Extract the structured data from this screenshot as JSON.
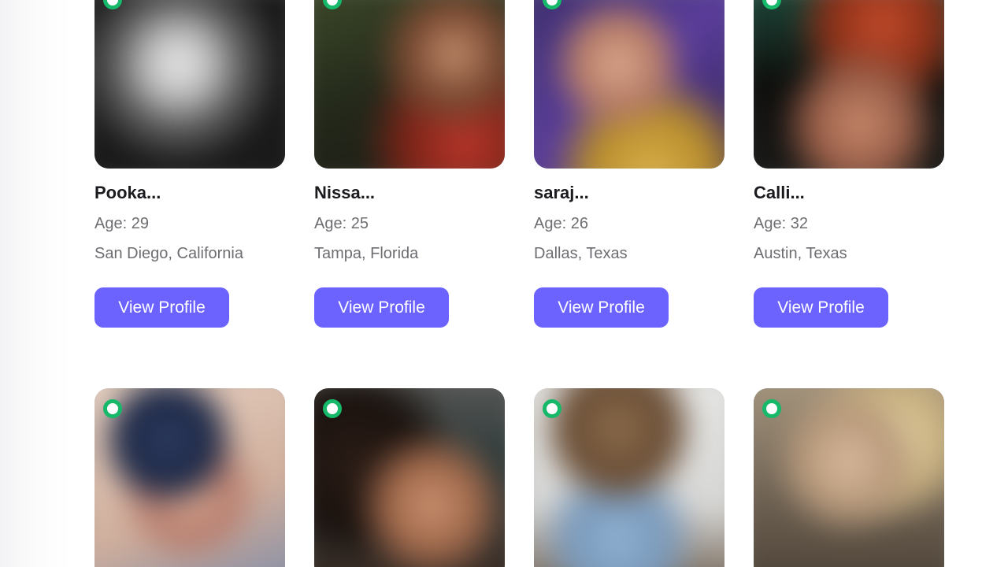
{
  "profiles_row1": [
    {
      "name": "Pooka...",
      "age": "Age: 29",
      "location": "San Diego, California",
      "button": "View Profile"
    },
    {
      "name": "Nissa...",
      "age": "Age: 25",
      "location": "Tampa, Florida",
      "button": "View Profile"
    },
    {
      "name": "saraj...",
      "age": "Age: 26",
      "location": "Dallas, Texas",
      "button": "View Profile"
    },
    {
      "name": "Calli...",
      "age": "Age: 32",
      "location": "Austin, Texas",
      "button": "View Profile"
    }
  ],
  "profiles_row2_count": 4,
  "colors": {
    "accent": "#6c63ff",
    "online": "#16b86a"
  }
}
